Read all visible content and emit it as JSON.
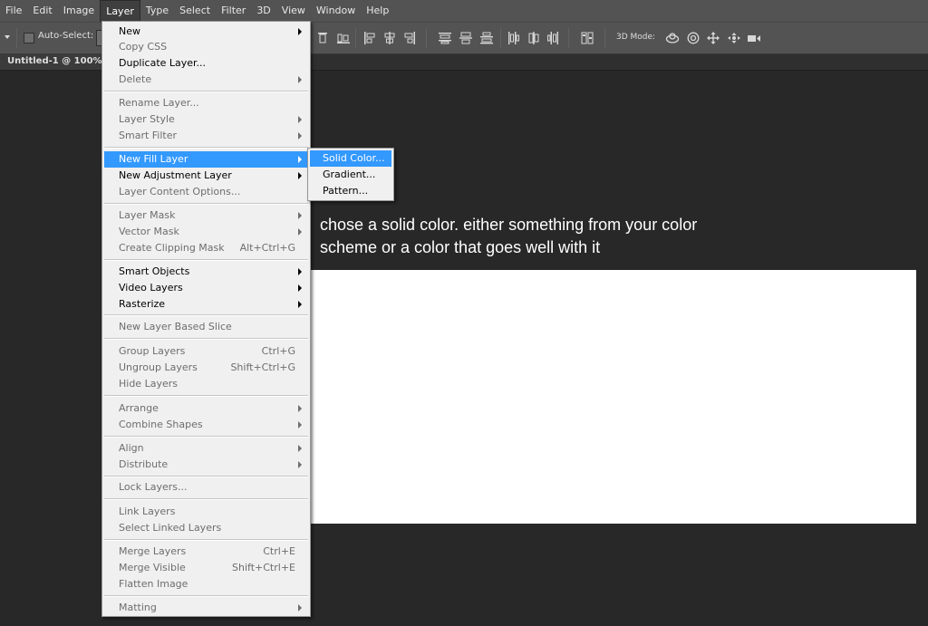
{
  "menubar": {
    "items": [
      "File",
      "Edit",
      "Image",
      "Layer",
      "Type",
      "Select",
      "Filter",
      "3D",
      "View",
      "Window",
      "Help"
    ],
    "active": "Layer"
  },
  "options_bar": {
    "auto_select_label": "Auto-Select:",
    "mode_3d_label": "3D Mode:"
  },
  "document_tab": {
    "title": "Untitled-1 @ 100% (R"
  },
  "layer_menu": {
    "items": [
      {
        "label": "New",
        "shortcut": "",
        "submenu": true,
        "disabled": false
      },
      {
        "label": "Copy CSS",
        "shortcut": "",
        "submenu": false,
        "disabled": true
      },
      {
        "label": "Duplicate Layer...",
        "shortcut": "",
        "submenu": false,
        "disabled": false
      },
      {
        "label": "Delete",
        "shortcut": "",
        "submenu": true,
        "disabled": true
      },
      {
        "label": "Rename Layer...",
        "shortcut": "",
        "submenu": false,
        "disabled": true
      },
      {
        "label": "Layer Style",
        "shortcut": "",
        "submenu": true,
        "disabled": true
      },
      {
        "label": "Smart Filter",
        "shortcut": "",
        "submenu": true,
        "disabled": true
      },
      {
        "label": "New Fill Layer",
        "shortcut": "",
        "submenu": true,
        "disabled": false,
        "highlighted": true
      },
      {
        "label": "New Adjustment Layer",
        "shortcut": "",
        "submenu": true,
        "disabled": false
      },
      {
        "label": "Layer Content Options...",
        "shortcut": "",
        "submenu": false,
        "disabled": true
      },
      {
        "label": "Layer Mask",
        "shortcut": "",
        "submenu": true,
        "disabled": true
      },
      {
        "label": "Vector Mask",
        "shortcut": "",
        "submenu": true,
        "disabled": true
      },
      {
        "label": "Create Clipping Mask",
        "shortcut": "Alt+Ctrl+G",
        "submenu": false,
        "disabled": true
      },
      {
        "label": "Smart Objects",
        "shortcut": "",
        "submenu": true,
        "disabled": false
      },
      {
        "label": "Video Layers",
        "shortcut": "",
        "submenu": true,
        "disabled": false
      },
      {
        "label": "Rasterize",
        "shortcut": "",
        "submenu": true,
        "disabled": false
      },
      {
        "label": "New Layer Based Slice",
        "shortcut": "",
        "submenu": false,
        "disabled": true
      },
      {
        "label": "Group Layers",
        "shortcut": "Ctrl+G",
        "submenu": false,
        "disabled": true
      },
      {
        "label": "Ungroup Layers",
        "shortcut": "Shift+Ctrl+G",
        "submenu": false,
        "disabled": true
      },
      {
        "label": "Hide Layers",
        "shortcut": "",
        "submenu": false,
        "disabled": true
      },
      {
        "label": "Arrange",
        "shortcut": "",
        "submenu": true,
        "disabled": true
      },
      {
        "label": "Combine Shapes",
        "shortcut": "",
        "submenu": true,
        "disabled": true
      },
      {
        "label": "Align",
        "shortcut": "",
        "submenu": true,
        "disabled": true
      },
      {
        "label": "Distribute",
        "shortcut": "",
        "submenu": true,
        "disabled": true
      },
      {
        "label": "Lock Layers...",
        "shortcut": "",
        "submenu": false,
        "disabled": true
      },
      {
        "label": "Link Layers",
        "shortcut": "",
        "submenu": false,
        "disabled": true
      },
      {
        "label": "Select Linked Layers",
        "shortcut": "",
        "submenu": false,
        "disabled": true
      },
      {
        "label": "Merge Layers",
        "shortcut": "Ctrl+E",
        "submenu": false,
        "disabled": true
      },
      {
        "label": "Merge Visible",
        "shortcut": "Shift+Ctrl+E",
        "submenu": false,
        "disabled": true
      },
      {
        "label": "Flatten Image",
        "shortcut": "",
        "submenu": false,
        "disabled": true
      },
      {
        "label": "Matting",
        "shortcut": "",
        "submenu": true,
        "disabled": true
      }
    ]
  },
  "fill_submenu": {
    "items": [
      {
        "label": "Solid Color...",
        "highlighted": true
      },
      {
        "label": "Gradient...",
        "highlighted": false
      },
      {
        "label": "Pattern...",
        "highlighted": false
      }
    ]
  },
  "annotation": {
    "line1": "chose a solid color. either something from your color",
    "line2": "scheme or a color that goes well with it"
  },
  "colors": {
    "workspace": "#282828",
    "menu_bg": "#f0f0f0",
    "highlight": "#3399ff",
    "canvas": "#ffffff"
  }
}
